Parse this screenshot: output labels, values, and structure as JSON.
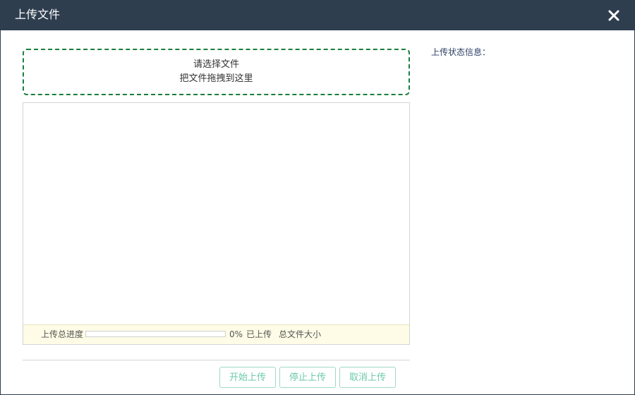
{
  "dialog": {
    "title": "上传文件",
    "close_icon": "close-icon"
  },
  "dropzone": {
    "line1": "请选择文件",
    "line2": "把文件拖拽到这里"
  },
  "progress": {
    "label": "上传总进度",
    "percent_text": "0%",
    "percent_value": 0,
    "uploaded_label": "已上传",
    "total_size_label": "总文件大小"
  },
  "buttons": {
    "start": "开始上传",
    "stop": "停止上传",
    "cancel": "取消上传"
  },
  "status": {
    "title": "上传状态信息："
  },
  "colors": {
    "titlebar": "#2f3e4f",
    "dropzone_border": "#1a7f3a",
    "button_text": "#6cc9a8",
    "progress_bg": "#fefce6"
  }
}
